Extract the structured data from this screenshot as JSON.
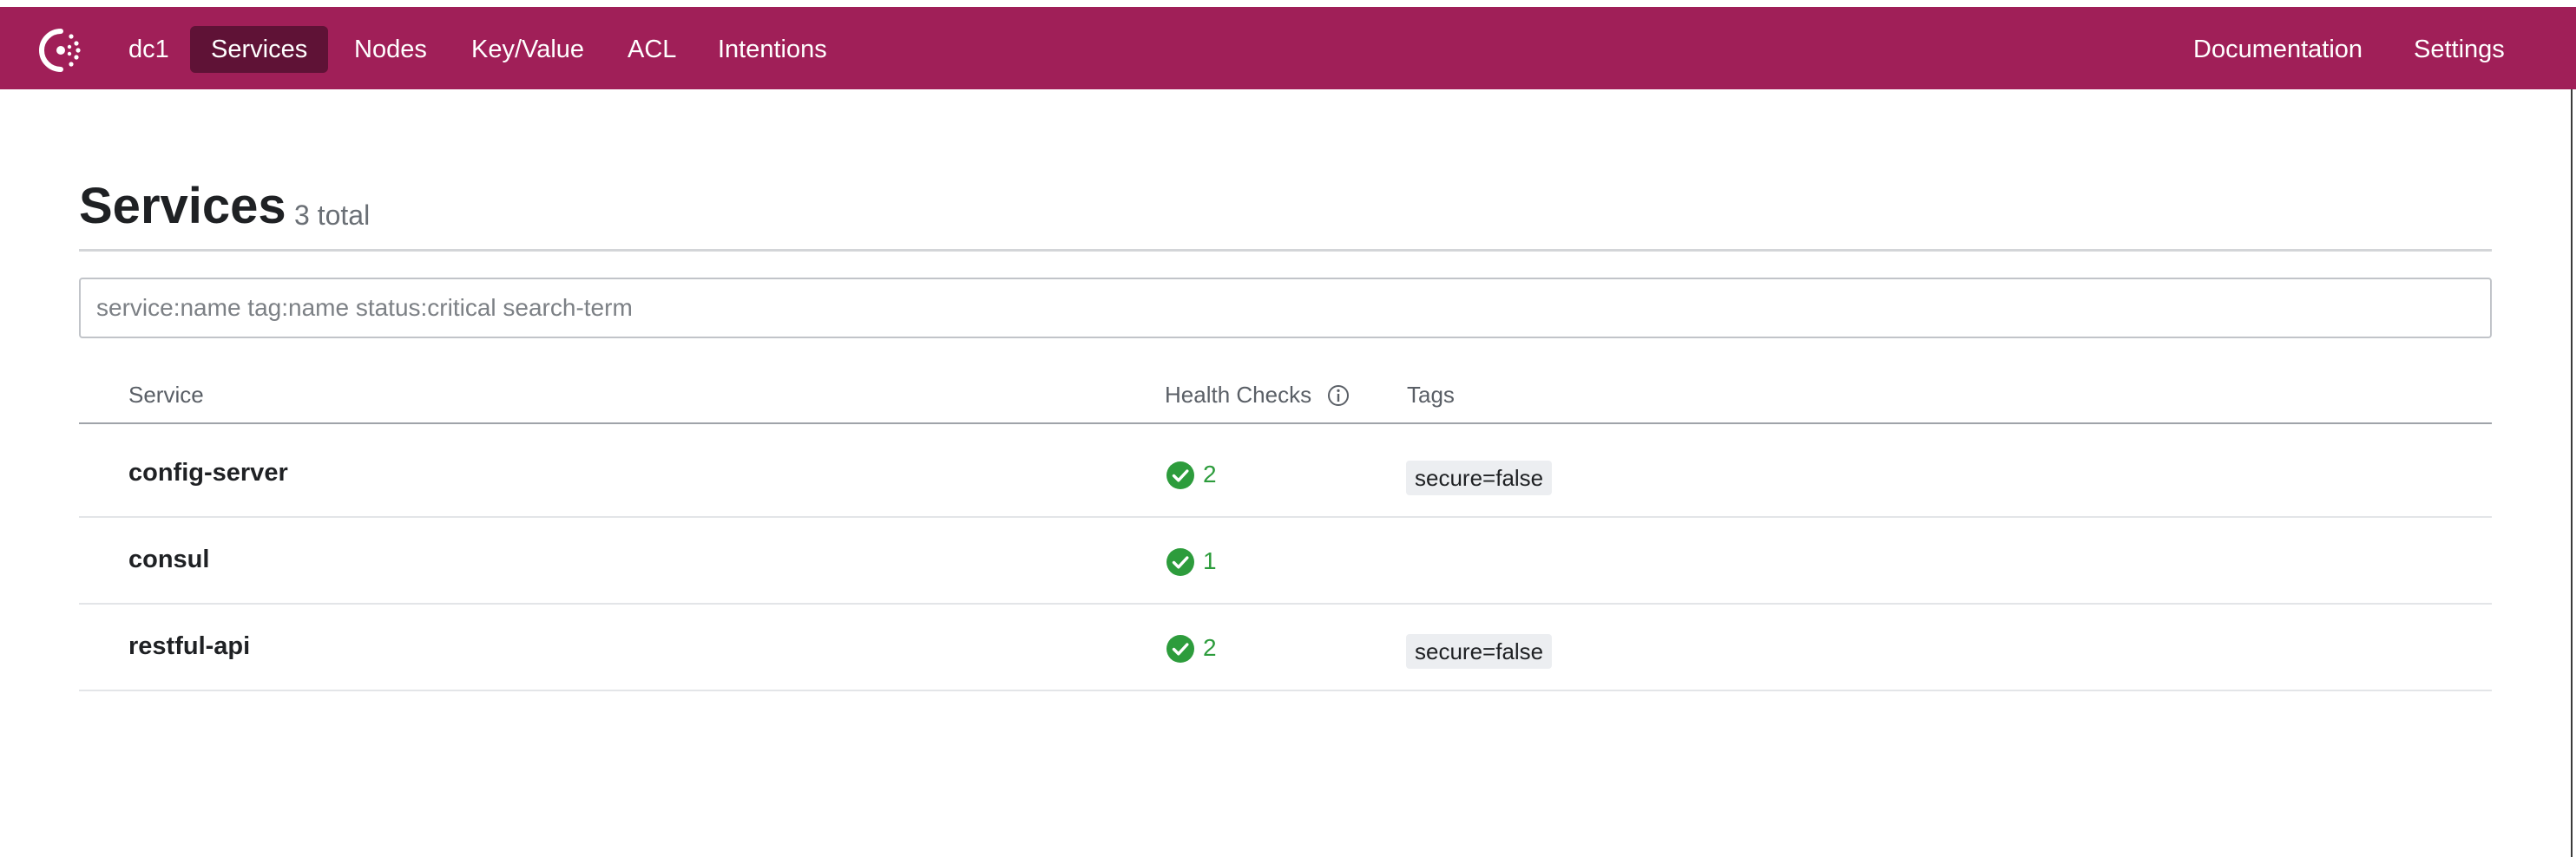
{
  "nav": {
    "datacenter": "dc1",
    "items": [
      {
        "label": "Services",
        "active": true
      },
      {
        "label": "Nodes",
        "active": false
      },
      {
        "label": "Key/Value",
        "active": false
      },
      {
        "label": "ACL",
        "active": false
      },
      {
        "label": "Intentions",
        "active": false
      }
    ],
    "right_items": [
      {
        "label": "Documentation"
      },
      {
        "label": "Settings"
      }
    ],
    "logo_icon": "consul-logo-icon",
    "bar_color": "#a01f58"
  },
  "page": {
    "title": "Services",
    "count": "3 total"
  },
  "search": {
    "placeholder": "service:name tag:name status:critical search-term",
    "value": ""
  },
  "table": {
    "columns": [
      "Service",
      "Health Checks",
      "Tags"
    ],
    "info_icon": "info-icon",
    "rows": [
      {
        "name": "config-server",
        "checks": "2",
        "tag": "secure=false"
      },
      {
        "name": "consul",
        "checks": "1",
        "tag": ""
      },
      {
        "name": "restful-api",
        "checks": "2",
        "tag": "secure=false"
      }
    ],
    "passing_color": "#2d9c3c"
  }
}
